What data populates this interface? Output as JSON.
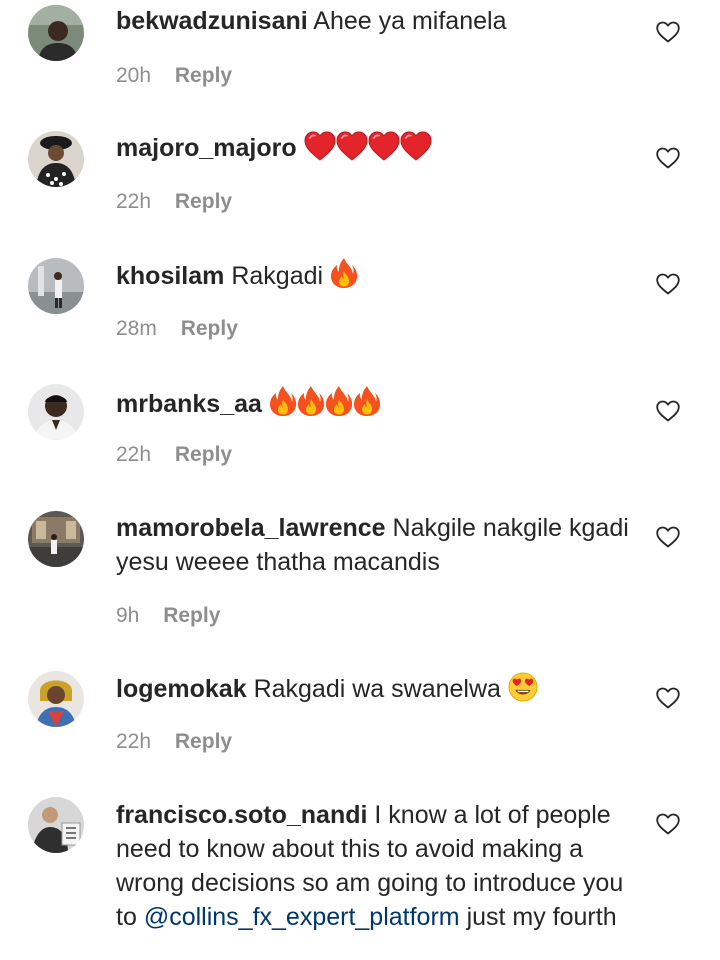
{
  "comments": [
    {
      "username": "bekwadzunisani",
      "text": "Ahee ya mifanela",
      "time": "20h",
      "reply": "Reply",
      "avatar": "user-avatar-photo",
      "like_icon": "heart-outline-icon"
    },
    {
      "username": "majoro_majoro",
      "text": "",
      "emojis": [
        "red-heart-emoji",
        "red-heart-emoji",
        "red-heart-emoji",
        "red-heart-emoji"
      ],
      "time": "22h",
      "reply": "Reply",
      "avatar": "user-avatar-photo",
      "like_icon": "heart-outline-icon"
    },
    {
      "username": "khosilam",
      "text": "Rakgadi",
      "emojis": [
        "fire-emoji"
      ],
      "time": "28m",
      "reply": "Reply",
      "avatar": "user-avatar-photo",
      "like_icon": "heart-outline-icon"
    },
    {
      "username": "mrbanks_aa",
      "text": "",
      "emojis": [
        "fire-emoji",
        "fire-emoji",
        "fire-emoji",
        "fire-emoji"
      ],
      "time": "22h",
      "reply": "Reply",
      "avatar": "user-avatar-photo",
      "like_icon": "heart-outline-icon"
    },
    {
      "username": "mamorobela_lawrence",
      "text": "Nakgile nakgile kgadi yesu weeee thatha macandis",
      "time": "9h",
      "reply": "Reply",
      "avatar": "user-avatar-photo",
      "like_icon": "heart-outline-icon"
    },
    {
      "username": "logemokak",
      "text": "Rakgadi wa swanelwa",
      "emojis": [
        "heart-eyes-emoji"
      ],
      "time": "22h",
      "reply": "Reply",
      "avatar": "user-avatar-photo",
      "like_icon": "heart-outline-icon"
    },
    {
      "username": "francisco.soto_nandi",
      "text": "I know a lot of people need to know about this to avoid making a wrong decisions so am going to introduce you to",
      "mention": "@collins_fx_expert_platform",
      "text_after": "just my fourth",
      "avatar": "user-avatar-photo",
      "like_icon": "heart-outline-icon"
    }
  ],
  "colors": {
    "text": "#262626",
    "secondary": "#8e8e8e",
    "mention": "#00376b",
    "emoji_red": "#e3242b",
    "fire_orange": "#f4511e",
    "fire_yellow": "#ffc107"
  }
}
